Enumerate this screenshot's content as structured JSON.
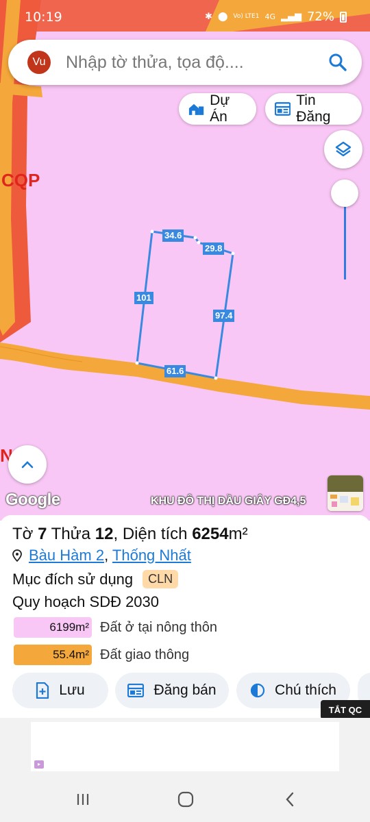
{
  "status_bar": {
    "time": "10:19",
    "network": "4G",
    "carrier_tag": "Vo) LTE1",
    "battery": "72%"
  },
  "search": {
    "avatar": "Vu",
    "placeholder": "Nhập tờ thửa, tọa độ....",
    "search_icon": "search-icon"
  },
  "chips": {
    "du_an": "Dự Án",
    "tin_dang": "Tin Đăng"
  },
  "map": {
    "zone_label": "CQP",
    "zone_label_2": "N",
    "google": "Google",
    "project_name": "KHU ĐÔ THỊ DẦU GIÂY GĐ4,5",
    "edges": [
      "34.6",
      "29.8",
      "101",
      "97.4",
      "61.6"
    ],
    "colors": {
      "residential": "#f9c7f5",
      "road": "#f4a73a",
      "defense": "#ee5a3c",
      "boundary": "#3a89e0"
    }
  },
  "parcel": {
    "to_label": "Tờ",
    "to_value": "7",
    "thua_label": "Thửa",
    "thua_value": "12",
    "area_label": "Diện tích",
    "area_value": "6254",
    "area_unit": "m²",
    "address_part1": "Bàu Hàm 2",
    "address_sep": ",",
    "address_part2": "Thống Nhất",
    "purpose_label": "Mục đích sử dụng",
    "purpose_code": "CLN",
    "plan_label": "Quy hoạch SDĐ 2030",
    "legend": [
      {
        "area": "6199m²",
        "label": "Đất ở tại nông thôn",
        "color": "#f9c7f5"
      },
      {
        "area": "55.4m²",
        "label": "Đất giao thông",
        "color": "#f4a73a"
      }
    ]
  },
  "actions": {
    "luu": "Lưu",
    "dang_ban": "Đăng bán",
    "chu_thich": "Chú thích"
  },
  "ad": {
    "close_label": "TẮT QC"
  }
}
